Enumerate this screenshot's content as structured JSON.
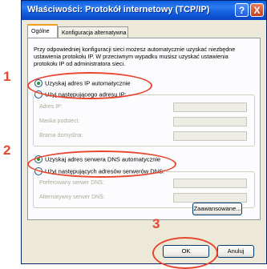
{
  "window": {
    "title": "Właściwości: Protokół internetowy (TCP/IP)",
    "help_label": "?",
    "close_label": "X"
  },
  "tabs": [
    {
      "label": "Ogólne",
      "active": true
    },
    {
      "label": "Konfiguracja alternatywna",
      "active": false
    }
  ],
  "description": "Przy odpowiedniej konfiguracji sieci możesz automatycznie uzyskać niezbędne ustawienia protokołu IP. W przeciwnym wypadku musisz uzyskać ustawienia protokołu IP od administratora sieci.",
  "ip_section": {
    "auto_label": "Uzyskaj adres IP automatycznie",
    "manual_label": "Użyj następującego adresu IP:",
    "selected": "auto",
    "fields": [
      {
        "label": "Adres IP:",
        "value": ""
      },
      {
        "label": "Maska podsieci:",
        "value": ""
      },
      {
        "label": "Brama domyślna:",
        "value": ""
      }
    ]
  },
  "dns_section": {
    "auto_label": "Uzyskaj adres serwera DNS automatycznie",
    "manual_label": "Użyj następujących adresów serwerów DNS:",
    "selected": "auto",
    "fields": [
      {
        "label": "Preferowany serwer DNS:",
        "value": ""
      },
      {
        "label": "Alternatywny serwer DNS:",
        "value": ""
      }
    ]
  },
  "buttons": {
    "advanced": "Zaawansowane...",
    "ok": "OK",
    "cancel": "Anuluj"
  },
  "annotations": {
    "step1": "1",
    "step2": "2",
    "step3": "3",
    "color": "#e8462f"
  }
}
